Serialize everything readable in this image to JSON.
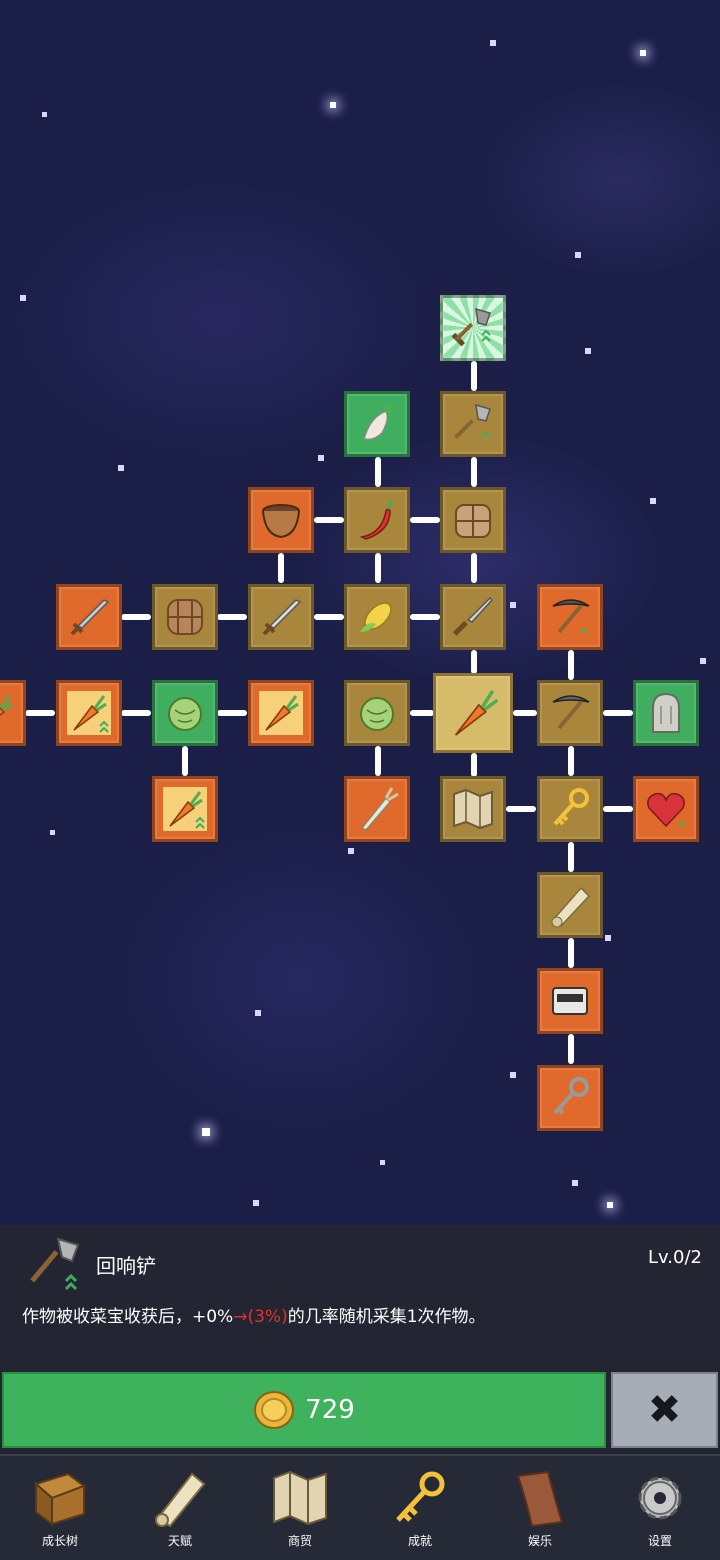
{
  "skill": {
    "name": "回响铲",
    "level": "Lv.0/2",
    "desc_prefix": "作物被收菜宝收获后，+0%",
    "desc_arrow": "→(3%)",
    "desc_suffix": "的几率随机采集1次作物。",
    "icon": "shovel-icon"
  },
  "buy": {
    "cost": "729",
    "icon": "gold-coin-icon"
  },
  "close": {
    "label": "✖"
  },
  "nav": [
    {
      "label": "成长树",
      "icon": "book-icon"
    },
    {
      "label": "天赋",
      "icon": "scroll-icon"
    },
    {
      "label": "商贸",
      "icon": "map-icon"
    },
    {
      "label": "成就",
      "icon": "key-icon"
    },
    {
      "label": "娱乐",
      "icon": "paper-icon"
    },
    {
      "label": "设置",
      "icon": "gear-icon"
    }
  ],
  "tree_nodes": [
    {
      "id": "shovel-top",
      "icon": "shovel-icon",
      "color": "greenglow"
    },
    {
      "id": "radish",
      "icon": "radish-icon",
      "color": "green"
    },
    {
      "id": "shovel-2",
      "icon": "shovel-icon",
      "color": "gold"
    },
    {
      "id": "bowl",
      "icon": "bowl-icon",
      "color": "orange"
    },
    {
      "id": "chili",
      "icon": "chili-icon",
      "color": "gold"
    },
    {
      "id": "basket-1",
      "icon": "basket-icon",
      "color": "gold"
    },
    {
      "id": "sword-1",
      "icon": "sword-icon",
      "color": "orange"
    },
    {
      "id": "basket-2",
      "icon": "basket-icon",
      "color": "gold"
    },
    {
      "id": "sword-2",
      "icon": "sword-icon",
      "color": "gold"
    },
    {
      "id": "corn",
      "icon": "corn-icon",
      "color": "gold"
    },
    {
      "id": "knife",
      "icon": "knife-icon",
      "color": "gold"
    },
    {
      "id": "pickaxe-1",
      "icon": "pickaxe-icon",
      "color": "orange"
    },
    {
      "id": "carrot-edge",
      "icon": "carrot-icon",
      "color": "orange"
    },
    {
      "id": "carrot-1",
      "icon": "carrot-icon",
      "color": "orange"
    },
    {
      "id": "cabbage-1",
      "icon": "cabbage-icon",
      "color": "green"
    },
    {
      "id": "carrot-2",
      "icon": "carrot-icon",
      "color": "orange"
    },
    {
      "id": "cabbage-2",
      "icon": "cabbage-icon",
      "color": "gold"
    },
    {
      "id": "carrot-center",
      "icon": "carrot-icon",
      "color": "selected"
    },
    {
      "id": "pickaxe-2",
      "icon": "pickaxe-icon",
      "color": "gold"
    },
    {
      "id": "ghost",
      "icon": "ghost-icon",
      "color": "green"
    },
    {
      "id": "carrot-3",
      "icon": "carrot-icon",
      "color": "orange"
    },
    {
      "id": "leek",
      "icon": "leek-icon",
      "color": "orange"
    },
    {
      "id": "map",
      "icon": "map-icon",
      "color": "gold"
    },
    {
      "id": "key-gold",
      "icon": "key-icon",
      "color": "gold"
    },
    {
      "id": "heart",
      "icon": "heart-icon",
      "color": "orange"
    },
    {
      "id": "scroll",
      "icon": "scroll-icon",
      "color": "gold"
    },
    {
      "id": "chest",
      "icon": "chest-icon",
      "color": "orange"
    },
    {
      "id": "key-iron",
      "icon": "iron-key-icon",
      "color": "orange"
    }
  ]
}
